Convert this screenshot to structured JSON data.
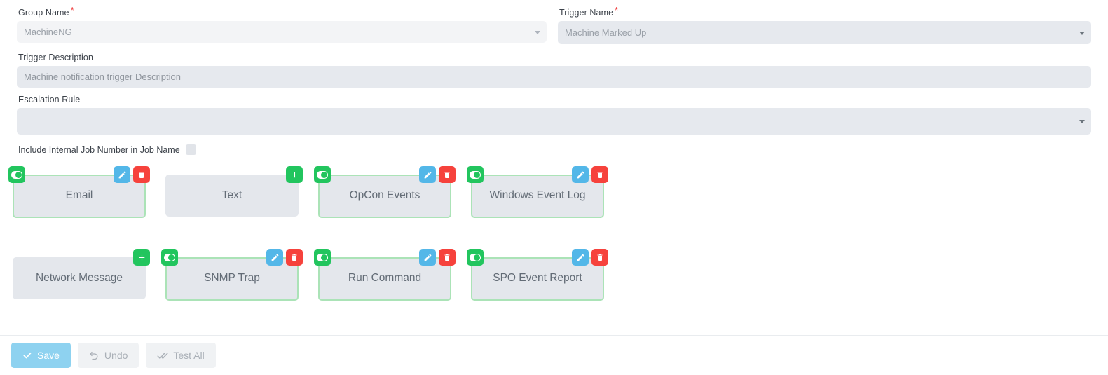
{
  "form": {
    "group_name": {
      "label": "Group Name",
      "required_marker": "*",
      "value": "MachineNG"
    },
    "trigger_name": {
      "label": "Trigger Name",
      "required_marker": "*",
      "value": "Machine Marked Up"
    },
    "trigger_description": {
      "label": "Trigger Description",
      "value": "Machine notification trigger Description"
    },
    "escalation_rule": {
      "label": "Escalation Rule",
      "value": ""
    },
    "include_internal_job_number": {
      "label": "Include Internal Job Number in Job Name",
      "checked": false
    }
  },
  "cards": {
    "rows": [
      [
        {
          "label": "Email",
          "active": true,
          "toggle_on": true
        },
        {
          "label": "Text",
          "active": false,
          "toggle_on": false
        },
        {
          "label": "OpCon Events",
          "active": true,
          "toggle_on": true
        },
        {
          "label": "Windows Event Log",
          "active": true,
          "toggle_on": true
        }
      ],
      [
        {
          "label": "Network Message",
          "active": false,
          "toggle_on": false
        },
        {
          "label": "SNMP Trap",
          "active": true,
          "toggle_on": true
        },
        {
          "label": "Run Command",
          "active": true,
          "toggle_on": true
        },
        {
          "label": "SPO Event Report",
          "active": true,
          "toggle_on": true
        }
      ]
    ],
    "add_label": "+"
  },
  "footer": {
    "save_label": "Save",
    "undo_label": "Undo",
    "test_all_label": "Test All"
  },
  "colors": {
    "green": "#22c55e",
    "green_border": "#abe3b7",
    "blue": "#53b7e8",
    "red": "#f6423c",
    "primary": "#8ed2f0",
    "field_bg": "#e6e9ee",
    "card_bg": "#e4e7ec",
    "required": "#f03f3f"
  }
}
